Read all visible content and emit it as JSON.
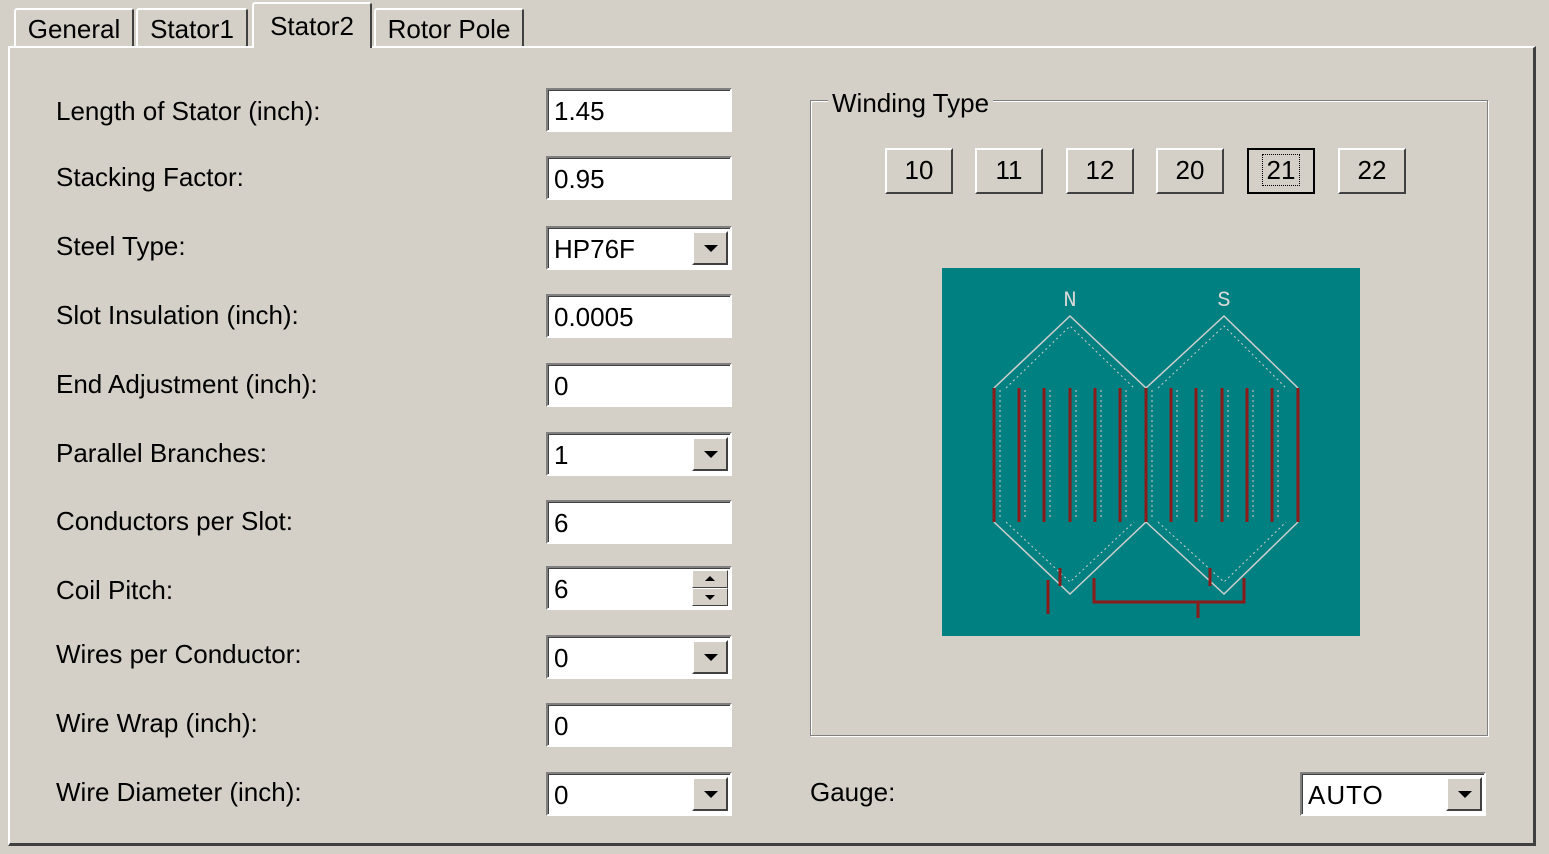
{
  "tabs": [
    {
      "label": "General"
    },
    {
      "label": "Stator1"
    },
    {
      "label": "Stator2"
    },
    {
      "label": "Rotor Pole"
    }
  ],
  "active_tab": "Stator2",
  "fields": {
    "length_of_stator": {
      "label": "Length of Stator (inch):",
      "value": "1.45"
    },
    "stacking_factor": {
      "label": "Stacking Factor:",
      "value": "0.95"
    },
    "steel_type": {
      "label": "Steel Type:",
      "value": "HP76F"
    },
    "slot_insulation": {
      "label": "Slot Insulation (inch):",
      "value": "0.0005"
    },
    "end_adjustment": {
      "label": "End Adjustment (inch):",
      "value": "0"
    },
    "parallel_branches": {
      "label": "Parallel Branches:",
      "value": "1"
    },
    "conductors_per_slot": {
      "label": "Conductors per Slot:",
      "value": "6"
    },
    "coil_pitch": {
      "label": "Coil Pitch:",
      "value": "6"
    },
    "wires_per_conductor": {
      "label": "Wires per Conductor:",
      "value": "0"
    },
    "wire_wrap": {
      "label": "Wire Wrap (inch):",
      "value": "0"
    },
    "wire_diameter": {
      "label": "Wire Diameter (inch):",
      "value": "0"
    }
  },
  "winding": {
    "title": "Winding Type",
    "options": [
      "10",
      "11",
      "12",
      "20",
      "21",
      "22"
    ],
    "selected": "21",
    "diagram": {
      "pole_north": "N",
      "pole_south": "S",
      "background": "#008080",
      "conductor_color": "#8b1a1a"
    }
  },
  "gauge": {
    "label": "Gauge:",
    "value": "AUTO"
  }
}
